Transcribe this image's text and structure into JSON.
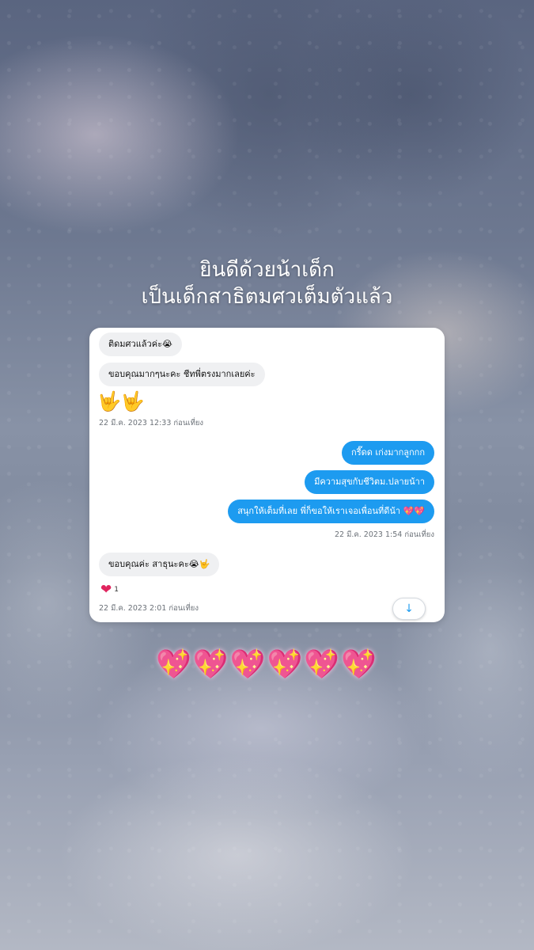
{
  "headline": {
    "line1": "ยินดีด้วยน้าเด็ก",
    "line2": "เป็นเด็กสาธิตมศวเต็มตัวแล้ว"
  },
  "chat": {
    "messages": [
      {
        "side": "in",
        "text": "ติดมศวแล้วค่ะ😭"
      },
      {
        "side": "in",
        "text": "ขอบคุณมากๆนะคะ ชีทพี่ตรงมากเลยค่ะ"
      },
      {
        "side": "in",
        "text": "🤟🤟"
      },
      {
        "side": "out",
        "text": "กรี๊ดด เก่งมากลูกกก"
      },
      {
        "side": "out",
        "text": "มีความสุขกับชีวิตม.ปลายน้าา"
      },
      {
        "side": "out",
        "text": "สนุกให้เต็มที่เลย พี่ก็ขอให้เราเจอเพื่อนที่ดีน้า 💖💖"
      },
      {
        "side": "in",
        "text": "ขอบคุณค่ะ สาธุนะคะ😭🤟"
      }
    ],
    "timestamps": [
      "22 มี.ค. 2023 12:33 ก่อนเที่ยง",
      "22 มี.ค. 2023 1:54 ก่อนเที่ยง",
      "22 มี.ค. 2023 2:01 ก่อนเที่ยง"
    ],
    "reaction": {
      "icon": "heart-icon",
      "count": "1",
      "color": "#e0245e"
    },
    "scroll_button_icon": "arrow-down-icon",
    "accent_color": "#1d9bf0"
  },
  "decoration": {
    "hearts": "💖💖💖💖💖💖"
  }
}
